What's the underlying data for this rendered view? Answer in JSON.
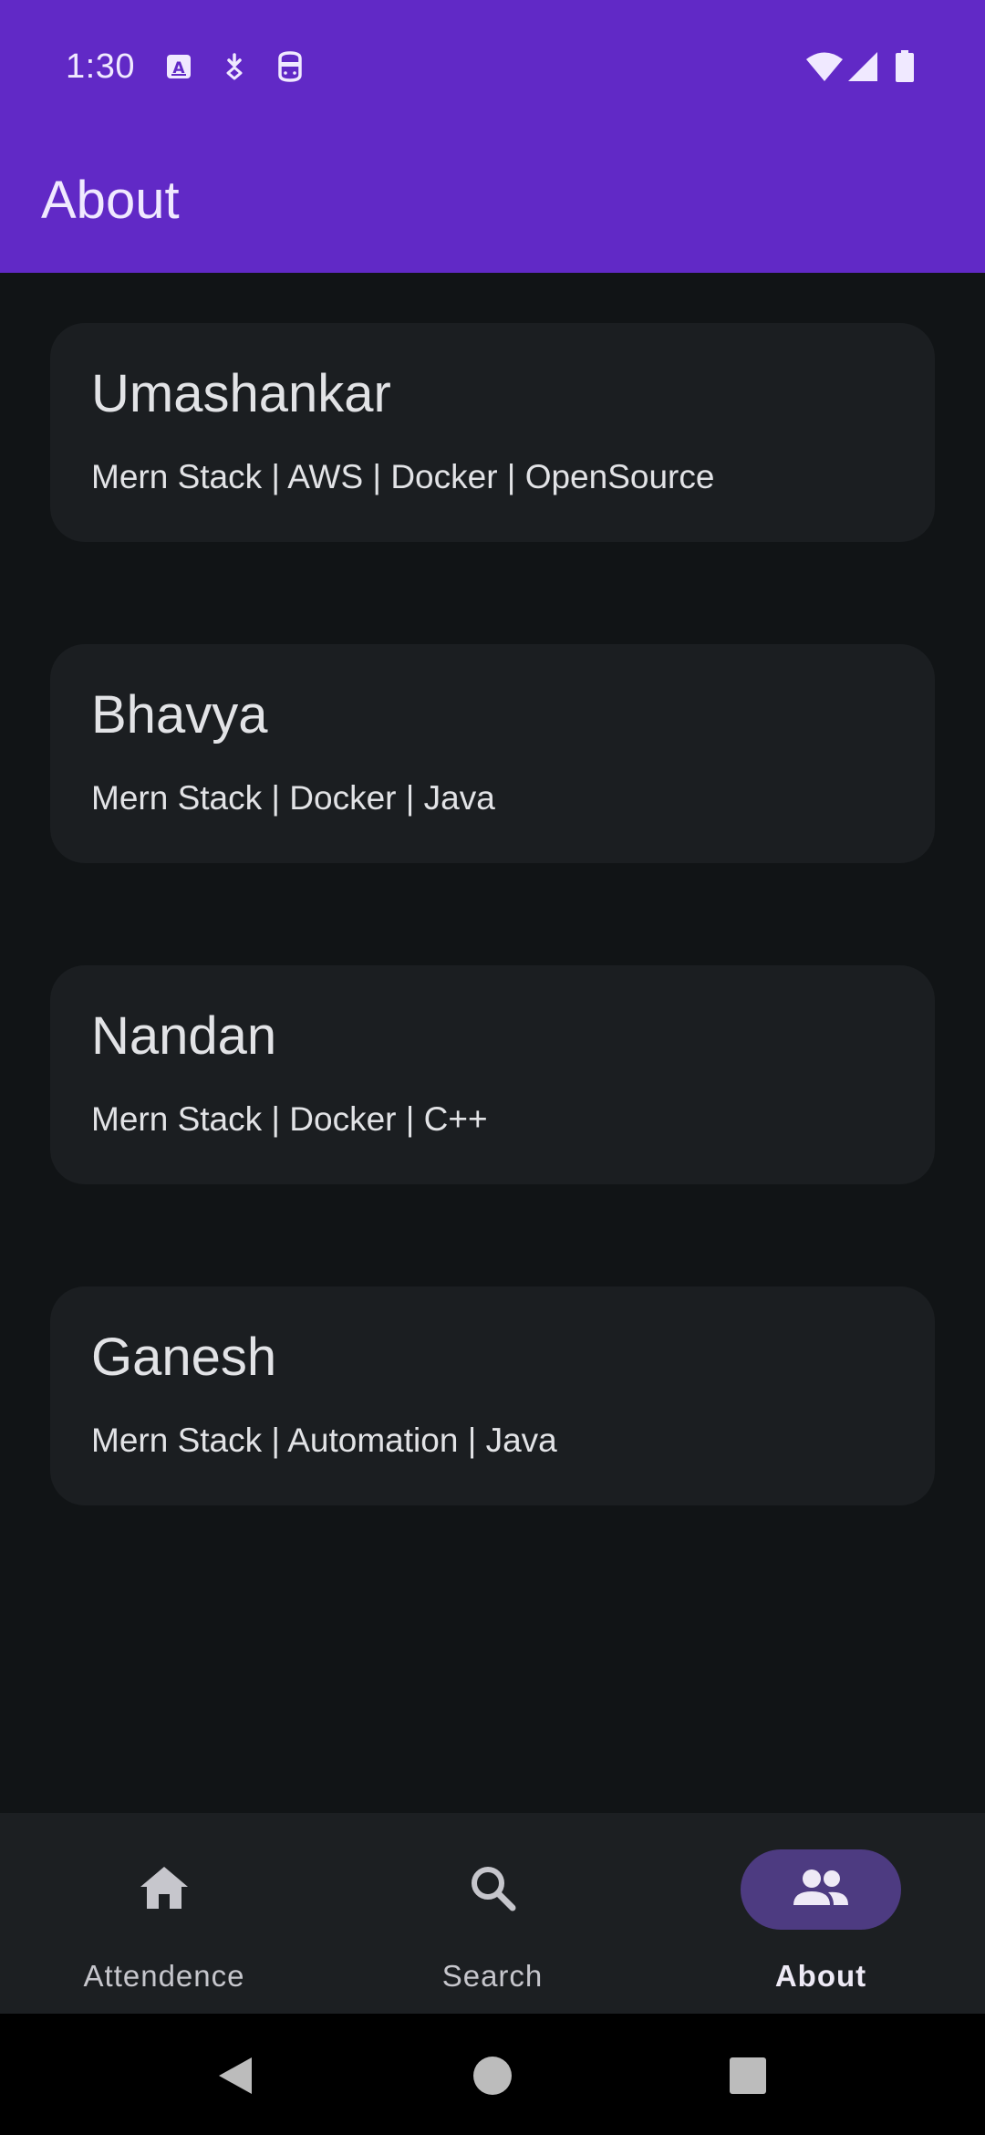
{
  "status_bar": {
    "time": "1:30",
    "left_icons": [
      "font-icon",
      "download-icon",
      "face-icon"
    ],
    "right_icons": [
      "wifi-icon",
      "signal-icon",
      "battery-icon"
    ]
  },
  "app_bar": {
    "title": "About",
    "color": "#6129c6"
  },
  "team": [
    {
      "name": "Umashankar",
      "skills": "Mern Stack | AWS | Docker | OpenSource"
    },
    {
      "name": "Bhavya",
      "skills": "Mern Stack | Docker | Java"
    },
    {
      "name": "Nandan",
      "skills": "Mern Stack | Docker | C++"
    },
    {
      "name": "Ganesh",
      "skills": "Mern Stack | Automation | Java"
    }
  ],
  "bottom_nav": {
    "items": [
      {
        "label": "Attendence",
        "icon": "home-icon",
        "active": false
      },
      {
        "label": "Search",
        "icon": "search-icon",
        "active": false
      },
      {
        "label": "About",
        "icon": "people-icon",
        "active": true
      }
    ],
    "active_color": "#4d3b81"
  },
  "system_nav": {
    "buttons": [
      "back-icon",
      "home-circle-icon",
      "recents-icon"
    ]
  }
}
